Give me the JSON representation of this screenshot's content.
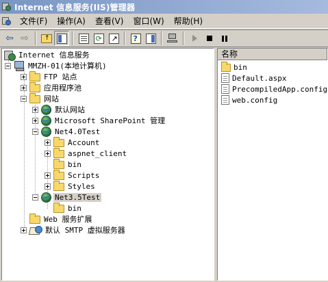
{
  "window": {
    "title": "Internet 信息服务(IIS)管理器"
  },
  "menu": {
    "items": [
      "文件(F)",
      "操作(A)",
      "查看(V)",
      "窗口(W)",
      "帮助(H)"
    ]
  },
  "toolbar": {
    "buttons": [
      {
        "name": "back-button",
        "icon": "back-arrow"
      },
      {
        "name": "forward-button",
        "icon": "forward-arrow"
      },
      {
        "name": "up-one-level-button",
        "icon": "folder-up"
      },
      {
        "name": "show-hide-tree-button",
        "icon": "console-tree"
      },
      {
        "name": "properties-button",
        "icon": "properties"
      },
      {
        "name": "refresh-button",
        "icon": "refresh"
      },
      {
        "name": "export-list-button",
        "icon": "export"
      },
      {
        "name": "help-button",
        "icon": "help"
      },
      {
        "name": "show-hide-action-pane-button",
        "icon": "action-pane"
      },
      {
        "name": "connect-button",
        "icon": "computer"
      },
      {
        "name": "start-button",
        "icon": "play"
      },
      {
        "name": "stop-button",
        "icon": "stop"
      },
      {
        "name": "pause-button",
        "icon": "pause"
      }
    ]
  },
  "tree": {
    "root": "Internet 信息服务",
    "server": "MMZH-01(本地计算机)",
    "ftp": "FTP 站点",
    "app_pools": "应用程序池",
    "websites": "网站",
    "default_site": "默认网站",
    "sharepoint": "Microsoft SharePoint 管理",
    "net40": "Net4.0Test",
    "account": "Account",
    "aspnet_client": "aspnet_client",
    "bin": "bin",
    "scripts": "Scripts",
    "styles": "Styles",
    "net35": "Net3.5Test",
    "net35_bin": "bin",
    "web_ext": "Web 服务扩展",
    "smtp": "默认 SMTP 虚拟服务器"
  },
  "list": {
    "column_name": "名称",
    "items": [
      {
        "name": "bin",
        "type": "folder"
      },
      {
        "name": "Default.aspx",
        "type": "file"
      },
      {
        "name": "PrecompiledApp.config",
        "type": "file"
      },
      {
        "name": "web.config",
        "type": "file"
      }
    ]
  },
  "colors": {
    "titlebar_start": "#7a96c4",
    "titlebar_end": "#a6bade",
    "chrome": "#d4d0c8",
    "folder": "#f6d86b"
  }
}
